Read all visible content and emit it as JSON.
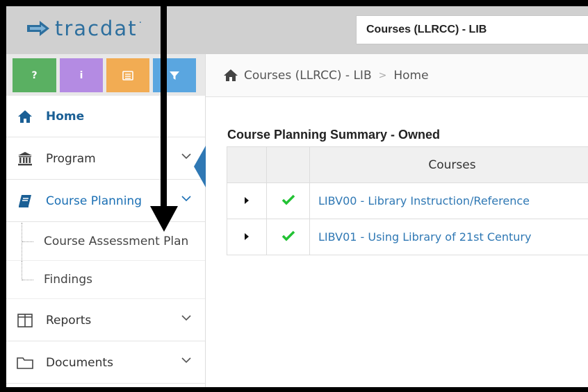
{
  "header": {
    "logo_text": "tracdat",
    "logo_mark": "·",
    "course_select_value": "Courses (LLRCC) - LIB"
  },
  "quick_buttons": [
    "?",
    "i",
    "",
    ""
  ],
  "sidebar": {
    "items": [
      {
        "label": "Home"
      },
      {
        "label": "Program"
      },
      {
        "label": "Course Planning"
      },
      {
        "label": "Course Assessment Plan"
      },
      {
        "label": "Findings"
      },
      {
        "label": "Reports"
      },
      {
        "label": "Documents"
      }
    ]
  },
  "breadcrumb": {
    "items": [
      "Courses (LLRCC) - LIB",
      "Home"
    ],
    "separator": ">"
  },
  "summary": {
    "title": "Course Planning Summary - Owned",
    "columns": [
      "",
      "",
      "Courses"
    ],
    "rows": [
      {
        "course": "LIBV00 - Library Instruction/Reference",
        "status": "complete"
      },
      {
        "course": "LIBV01 - Using Library of 21st Century",
        "status": "complete"
      }
    ]
  },
  "colors": {
    "accent": "#2f78b4",
    "help": "#5ab062",
    "info": "#b48be3",
    "notes": "#f2ac53",
    "filter": "#5aa6e0",
    "check": "#22c234"
  }
}
